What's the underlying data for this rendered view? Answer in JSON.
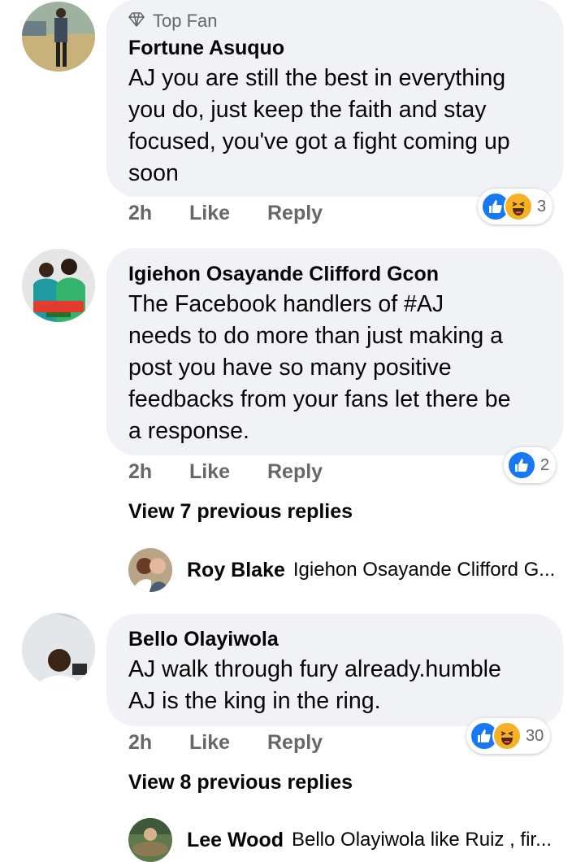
{
  "comments": [
    {
      "badge": "Top Fan",
      "author": "Fortune Asuquo",
      "lines": [
        "AJ you are still the best in everything",
        "you do, just keep the faith and stay",
        "focused, you've got a fight coming up",
        "soon"
      ],
      "time": "2h",
      "like": "Like",
      "reply": "Reply",
      "reaction_count": "3"
    },
    {
      "author": "Igiehon Osayande Clifford Gcon",
      "lines": [
        "The Facebook handlers  of #AJ",
        "needs to do more than just making a",
        "post you have so many positive",
        "feedbacks from your fans let there be",
        "a response."
      ],
      "time": "2h",
      "like": "Like",
      "reply": "Reply",
      "reaction_count": "2",
      "view_previous": "View 7 previous replies",
      "latest_reply": {
        "author": "Roy Blake",
        "text": "Igiehon Osayande Clifford G..."
      }
    },
    {
      "author": "Bello Olayiwola",
      "lines": [
        "AJ walk through fury already.humble",
        "AJ is the king in the ring."
      ],
      "time": "2h",
      "like": "Like",
      "reply": "Reply",
      "reaction_count": "30",
      "view_previous": "View 8 previous replies",
      "latest_reply": {
        "author": "Lee Wood",
        "text": "Bello Olayiwola like Ruiz , fir..."
      }
    }
  ],
  "colors": {
    "bubble": "#f0f2f5",
    "secondary_text": "#65676b",
    "like_blue": "#1877f2",
    "haha_yellow": "#f7b125"
  },
  "icons": [
    "diamond-icon",
    "like-reaction-icon",
    "haha-reaction-icon"
  ]
}
